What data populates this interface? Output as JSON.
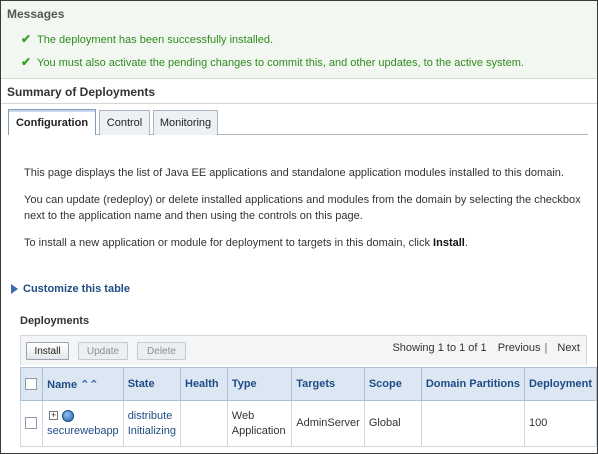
{
  "messages": {
    "header": "Messages",
    "items": [
      "The deployment has been successfully installed.",
      "You must also activate the pending changes to commit this, and other updates, to the active system."
    ]
  },
  "summary": {
    "title": "Summary of Deployments",
    "tabs": [
      "Configuration",
      "Control",
      "Monitoring"
    ],
    "active_tab": "Configuration"
  },
  "description": {
    "p1": "This page displays the list of Java EE applications and standalone application modules installed to this domain.",
    "p2": "You can update (redeploy) or delete installed applications and modules from the domain by selecting the checkbox next to the application name and then using the controls on this page.",
    "p3_prefix": "To install a new application or module for deployment to targets in this domain, click ",
    "p3_bold": "Install",
    "p3_suffix": "."
  },
  "customize_link": "Customize this table",
  "deployments": {
    "title": "Deployments",
    "buttons": {
      "install": "Install",
      "update": "Update",
      "delete": "Delete"
    },
    "pager": {
      "showing": "Showing 1 to 1 of 1",
      "previous": "Previous",
      "next": "Next"
    },
    "columns": [
      "Name",
      "State",
      "Health",
      "Type",
      "Targets",
      "Scope",
      "Domain Partitions",
      "Deployment"
    ],
    "rows": [
      {
        "name": "securewebapp",
        "state_line1": "distribute",
        "state_line2": "Initializing",
        "health": "",
        "type_line1": "Web",
        "type_line2": "Application",
        "targets": "AdminServer",
        "scope": "Global",
        "domain_partitions": "",
        "deployment": "100"
      }
    ]
  },
  "colors": {
    "success_text": "#2e8b1f",
    "link": "#1f4c84",
    "header_bg": "#dce7f3"
  },
  "icons": [
    "check-icon",
    "expand-triangle-icon",
    "sort-ascending-icon",
    "expand-plus-icon",
    "web-app-icon"
  ]
}
